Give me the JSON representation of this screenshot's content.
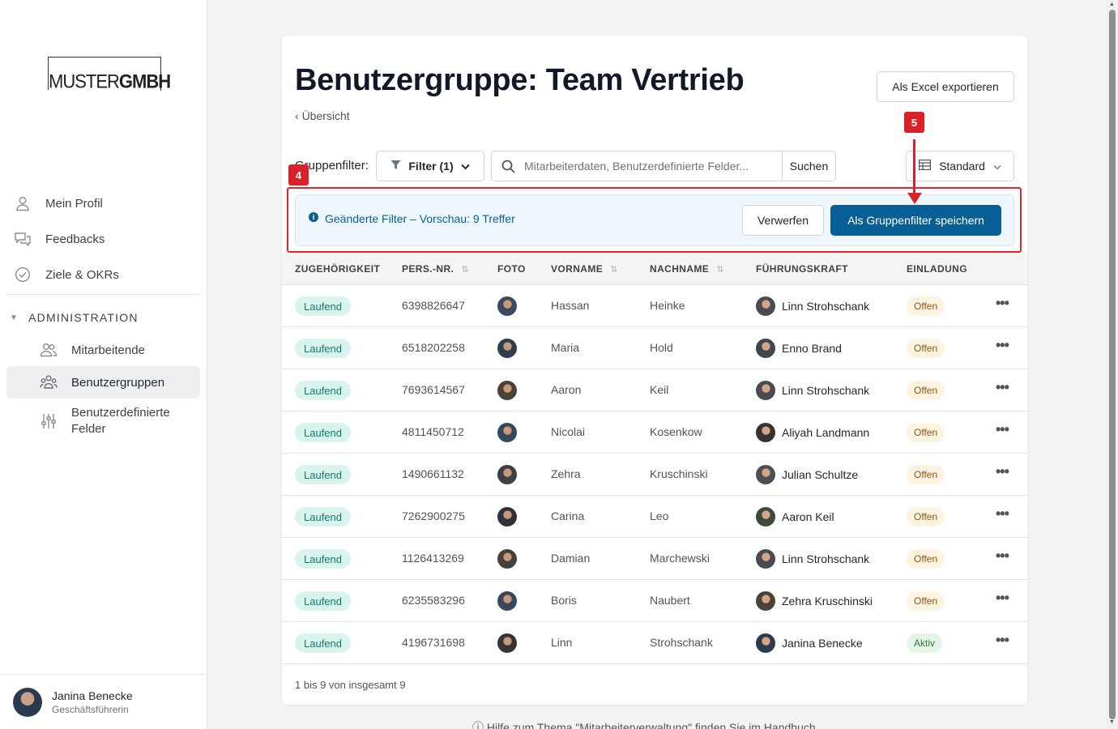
{
  "logo": {
    "part1": "MUSTER",
    "part2": "GMBH"
  },
  "nav": {
    "my_profile": "Mein Profil",
    "feedbacks": "Feedbacks",
    "goals": "Ziele & OKRs",
    "admin_section": "ADMINISTRATION",
    "employees": "Mitarbeitende",
    "user_groups": "Benutzergruppen",
    "custom_fields": "Benutzerdefinierte Felder"
  },
  "user": {
    "name": "Janina Benecke",
    "role": "Geschäftsführerin"
  },
  "page": {
    "title": "Benutzergruppe: Team Vertrieb",
    "back_link": "Übersicht",
    "export_button": "Als Excel exportieren"
  },
  "toolbar": {
    "group_filter_label": "Gruppenfilter:",
    "filter_button": "Filter (1)",
    "search_placeholder": "Mitarbeiterdaten, Benutzerdefinierte Felder...",
    "search_button": "Suchen",
    "view_select": "Standard"
  },
  "info_bar": {
    "message": "Geänderte Filter – Vorschau: 9 Treffer",
    "discard_button": "Verwerfen",
    "save_button": "Als Gruppenfilter speichern"
  },
  "annotations": {
    "badge_4": "4",
    "badge_5": "5",
    "color": "#d92127"
  },
  "table": {
    "columns": [
      "ZUGEHÖRIGKEIT",
      "PERS.-NR.",
      "FOTO",
      "VORNAME",
      "NACHNAME",
      "FÜHRUNGSKRAFT",
      "EINLADUNG"
    ],
    "rows": [
      {
        "membership": "Laufend",
        "pers_nr": "6398826647",
        "first_name": "Hassan",
        "last_name": "Heinke",
        "manager": "Linn Strohschank",
        "invitation": "Offen"
      },
      {
        "membership": "Laufend",
        "pers_nr": "6518202258",
        "first_name": "Maria",
        "last_name": "Hold",
        "manager": "Enno Brand",
        "invitation": "Offen"
      },
      {
        "membership": "Laufend",
        "pers_nr": "7693614567",
        "first_name": "Aaron",
        "last_name": "Keil",
        "manager": "Linn Strohschank",
        "invitation": "Offen"
      },
      {
        "membership": "Laufend",
        "pers_nr": "4811450712",
        "first_name": "Nicolai",
        "last_name": "Kosenkow",
        "manager": "Aliyah Landmann",
        "invitation": "Offen"
      },
      {
        "membership": "Laufend",
        "pers_nr": "1490661132",
        "first_name": "Zehra",
        "last_name": "Kruschinski",
        "manager": "Julian Schultze",
        "invitation": "Offen"
      },
      {
        "membership": "Laufend",
        "pers_nr": "7262900275",
        "first_name": "Carina",
        "last_name": "Leo",
        "manager": "Aaron Keil",
        "invitation": "Offen"
      },
      {
        "membership": "Laufend",
        "pers_nr": "1126413269",
        "first_name": "Damian",
        "last_name": "Marchewski",
        "manager": "Linn Strohschank",
        "invitation": "Offen"
      },
      {
        "membership": "Laufend",
        "pers_nr": "6235583296",
        "first_name": "Boris",
        "last_name": "Naubert",
        "manager": "Zehra Kruschinski",
        "invitation": "Offen"
      },
      {
        "membership": "Laufend",
        "pers_nr": "4196731698",
        "first_name": "Linn",
        "last_name": "Strohschank",
        "manager": "Janina Benecke",
        "invitation": "Aktiv"
      }
    ],
    "footer": "1 bis 9 von insgesamt 9"
  },
  "help_text": "Hilfe zum Thema \"Mitarbeiterverwaltung\" finden Sie im Handbuch",
  "colors": {
    "primary": "#075f95",
    "pill_green_bg": "#d9f3ee",
    "pill_orange_bg": "#fdf3e1"
  }
}
